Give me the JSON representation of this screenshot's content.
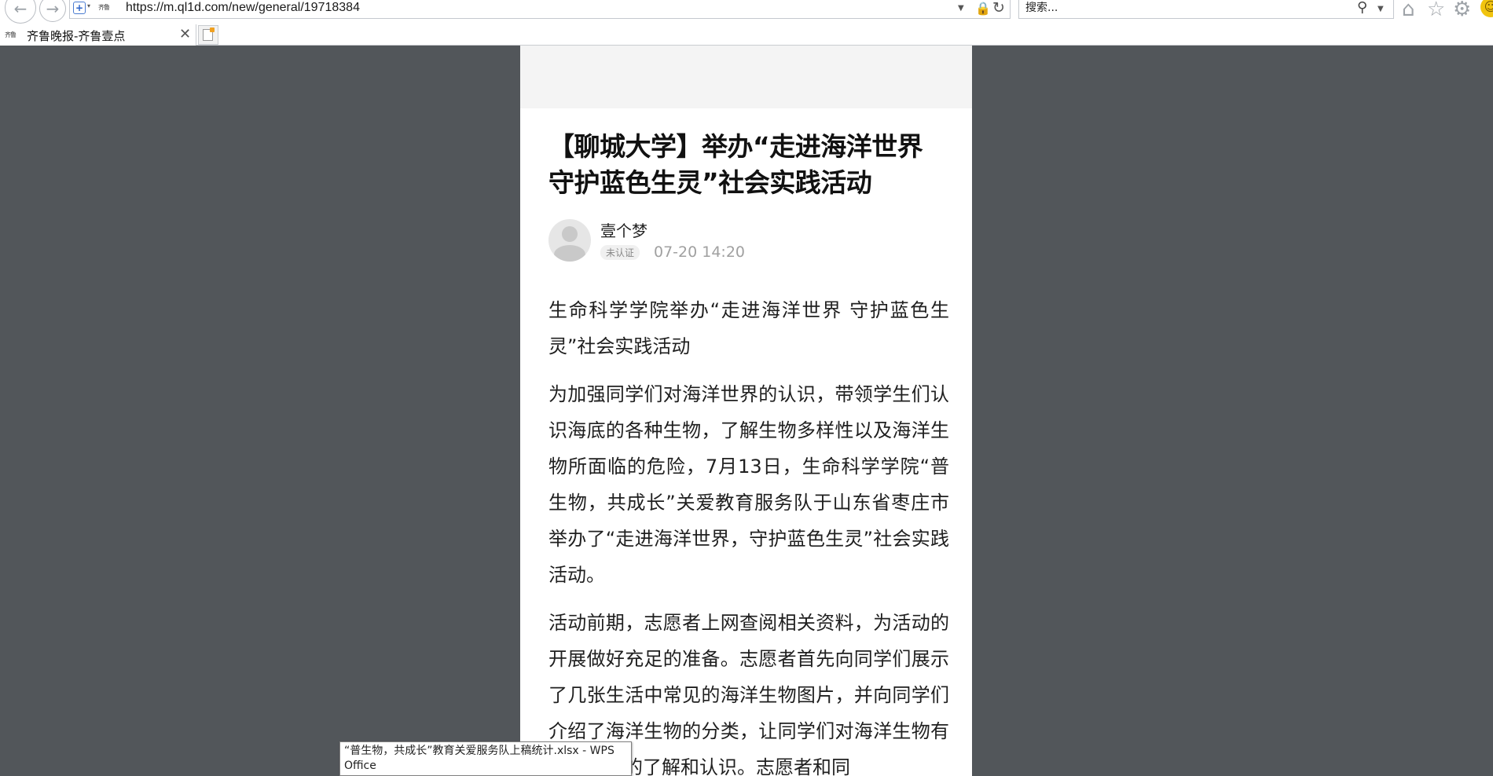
{
  "browser": {
    "url": "https://m.ql1d.com/new/general/19718384",
    "search_placeholder": "搜索...",
    "site_favicon_text": "齐鲁",
    "icons": {
      "back": "back-arrow-icon",
      "forward": "forward-arrow-icon",
      "compat": "compat-view-icon",
      "lock": "lock-icon",
      "refresh": "refresh-icon",
      "search": "search-icon",
      "home": "home-icon",
      "favorites": "star-icon",
      "tools": "gear-icon",
      "feedback": "smiley-icon"
    }
  },
  "tabs": [
    {
      "title": "齐鲁晚报-齐鲁壹点",
      "active": true
    }
  ],
  "article": {
    "title": "【聊城大学】举办“走进海洋世界 守护蓝色生灵”社会实践活动",
    "author": "壹个梦",
    "badge": "未认证",
    "time": "07-20 14:20",
    "paragraphs": [
      "生命科学学院举办“走进海洋世界 守护蓝色生灵”社会实践活动",
      "为加强同学们对海洋世界的认识，带领学生们认识海底的各种生物，了解生物多样性以及海洋生物所面临的危险，7月13日，生命科学学院“普生物，共成长”关爱教育服务队于山东省枣庄市举办了“走进海洋世界，守护蓝色生灵”社会实践活动。",
      "活动前期，志愿者上网查阅相关资料，为活动的开展做好充足的准备。志愿者首先向同学们展示了几张生活中常见的海洋生物图片，并向同学们介绍了海洋生物的分类，让同学们对海洋生物有一个初步的了解和认识。志愿者和同"
    ]
  },
  "tooltip": {
    "text": "“普生物，共成长”教育关爱服务队上稿统计.xlsx - WPS Office"
  },
  "colors": {
    "page_background": "#52565a",
    "chrome_background": "#ffffff",
    "article_background": "#ffffff",
    "meta_gray": "#a0a0a0"
  }
}
